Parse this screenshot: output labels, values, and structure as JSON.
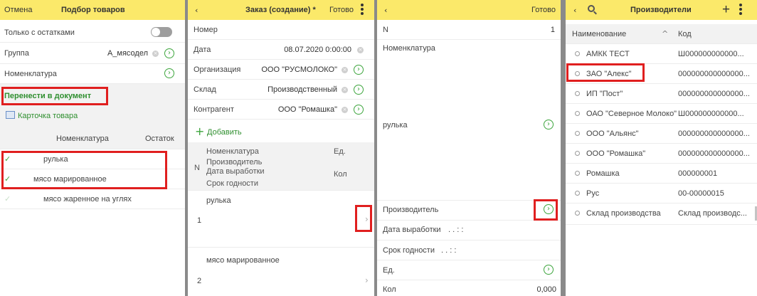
{
  "panel1": {
    "cancel": "Отмена",
    "title": "Подбор товаров",
    "only_remaining_label": "Только с остатками",
    "group_label": "Группа",
    "group_value": "А_мясодел",
    "nomenclature_label": "Номенклатура",
    "transfer_label": "Перенести в документ",
    "card_label": "Карточка товара",
    "col_nomenclature": "Номенклатура",
    "col_remaining": "Остаток",
    "items": [
      "рулька",
      "мясо марированное",
      "мясо жаренное на углях"
    ]
  },
  "panel2": {
    "title": "Заказ (создание) *",
    "done": "Готово",
    "number_label": "Номер",
    "date_label": "Дата",
    "date_value": "08.07.2020  0:00:00",
    "org_label": "Организация",
    "org_value": "ООО \"РУСМОЛОКО\"",
    "warehouse_label": "Склад",
    "warehouse_value": "Производственный",
    "contractor_label": "Контрагент",
    "contractor_value": "ООО \"Ромашка\"",
    "add_label": "Добавить",
    "col_n": "N",
    "col_nomenclature": "Номенклатура",
    "col_producer": "Производитель",
    "col_production_date": "Дата выработки",
    "col_shelf_life": "Срок годности",
    "col_unit": "Ед.",
    "col_qty": "Кол",
    "rows": [
      {
        "num": "1",
        "name": "рулька"
      },
      {
        "num": "2",
        "name": "мясо марированное"
      }
    ]
  },
  "panel3": {
    "done": "Готово",
    "n_label": "N",
    "n_value": "1",
    "nomenclature_label": "Номенклатура",
    "nomenclature_value": "рулька",
    "producer_label": "Производитель",
    "production_date_label": "Дата выработки",
    "production_date_value": ". .     : :",
    "shelf_life_label": "Срок годности",
    "shelf_life_value": ". .     : :",
    "unit_label": "Ед.",
    "qty_label": "Кол",
    "qty_value": "0,000"
  },
  "panel4": {
    "title": "Производители",
    "plus": "+",
    "col_name": "Наименование",
    "col_code": "Код",
    "rows": [
      {
        "name": "АМКК ТЕСТ",
        "code": "Ш000000000000..."
      },
      {
        "name": "ЗАО \"Алекс\"",
        "code": "000000000000000..."
      },
      {
        "name": "ИП \"Пост\"",
        "code": "000000000000000..."
      },
      {
        "name": "ОАО \"Северное Молоко\"",
        "code": "Ш000000000000..."
      },
      {
        "name": "ООО \"Альянс\"",
        "code": "000000000000000..."
      },
      {
        "name": "ООО \"Ромашка\"",
        "code": "000000000000000..."
      },
      {
        "name": "Ромашка",
        "code": "000000001"
      },
      {
        "name": "Рус",
        "code": "00-00000015"
      },
      {
        "name": "Склад производства",
        "code": "Склад производс..."
      }
    ]
  }
}
